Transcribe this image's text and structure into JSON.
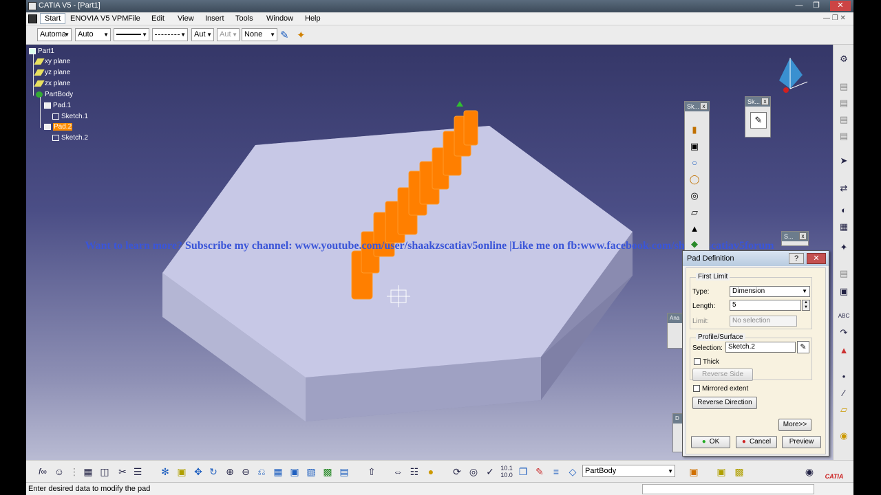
{
  "window": {
    "title": "CATIA V5 - [Part1]",
    "min_icon": "minimize-icon",
    "max_icon": "restore-icon",
    "close_icon": "close-icon"
  },
  "menubar": {
    "items": [
      "Start",
      "ENOVIA V5 VPM",
      "File",
      "Edit",
      "View",
      "Insert",
      "Tools",
      "Window",
      "Help"
    ]
  },
  "toolbar": {
    "combo1": "Automa",
    "combo2": "Auto",
    "combo5": "Aut",
    "combo6": "Aut",
    "combo7": "None"
  },
  "tree": {
    "root": "Part1",
    "items": [
      "xy plane",
      "yz plane",
      "zx plane",
      "PartBody",
      "Pad.1",
      "Sketch.1",
      "Pad.2",
      "Sketch.2"
    ]
  },
  "watermark": "Want to learn more? Subscribe my channel: www.youtube.com/user/shaakzscatiav5online |Like me on fb:www.facebook.com/shaakzscatiav5forum",
  "floating_toolbars": {
    "sketch_based": "Sk...",
    "sketcher": "Sk...",
    "small": "S...",
    "analysis": "Ana",
    "other": "D"
  },
  "pad_dialog": {
    "title": "Pad Definition",
    "first_limit": {
      "label": "First Limit",
      "type_label": "Type:",
      "type_value": "Dimension",
      "length_label": "Length:",
      "length_value": "5",
      "limit_label": "Limit:",
      "limit_value": "No selection"
    },
    "profile": {
      "label": "Profile/Surface",
      "selection_label": "Selection:",
      "selection_value": "Sketch.2",
      "thick_label": "Thick",
      "reverse_side_label": "Reverse Side"
    },
    "mirrored_label": "Mirrored extent",
    "reverse_direction_label": "Reverse Direction",
    "more_label": "More>>",
    "ok_label": "OK",
    "cancel_label": "Cancel",
    "preview_label": "Preview"
  },
  "bottom": {
    "body_select": "PartBody",
    "logo": "CATIA"
  },
  "status": {
    "message": "Enter desired data to modify the pad"
  }
}
